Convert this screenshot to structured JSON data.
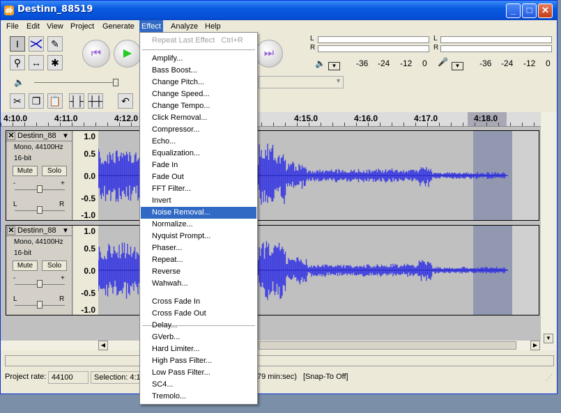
{
  "window": {
    "title": "Destinn_88519"
  },
  "titlebar_buttons": [
    "_",
    "□",
    "✕"
  ],
  "menu": [
    {
      "label": "File",
      "active": false
    },
    {
      "label": "Edit",
      "active": false
    },
    {
      "label": "View",
      "active": false
    },
    {
      "label": "Project",
      "active": false
    },
    {
      "label": "Generate",
      "active": false
    },
    {
      "label": "Effect",
      "active": true
    },
    {
      "label": "Analyze",
      "active": false
    },
    {
      "label": "Help",
      "active": false
    }
  ],
  "effect_menu": {
    "repeat_last": "Repeat Last Effect",
    "repeat_shortcut": "Ctrl+R",
    "group1": [
      "Amplify...",
      "Bass Boost...",
      "Change Pitch...",
      "Change Speed...",
      "Change Tempo...",
      "Click Removal...",
      "Compressor...",
      "Echo...",
      "Equalization...",
      "Fade In",
      "Fade Out",
      "FFT Filter...",
      "Invert",
      "Noise Removal...",
      "Normalize...",
      "Nyquist Prompt...",
      "Phaser...",
      "Repeat...",
      "Reverse",
      "Wahwah..."
    ],
    "group2": [
      "Cross Fade In",
      "Cross Fade Out",
      "Delay...",
      "GVerb...",
      "Hard Limiter...",
      "High Pass Filter...",
      "Low Pass Filter...",
      "SC4...",
      "Tremolo..."
    ],
    "highlighted": "Noise Removal..."
  },
  "meters": {
    "playback_scale": [
      "-36",
      "-24",
      "-12",
      "0"
    ],
    "record_scale": [
      "-36",
      "-24",
      "-12",
      "0"
    ],
    "lr": [
      "L",
      "R"
    ]
  },
  "ruler": {
    "labels": [
      "4:10.0",
      "4:11.0",
      "4:12.0",
      "4:15.0",
      "4:16.0",
      "4:17.0",
      "4:18.0"
    ]
  },
  "tracks": [
    {
      "name": "Destinn_88",
      "info1": "Mono, 44100Hz",
      "info2": "16-bit",
      "mute": "Mute",
      "solo": "Solo",
      "gain_minus": "-",
      "gain_plus": "+",
      "pan_l": "L",
      "pan_r": "R",
      "scale": [
        "1.0",
        "0.5",
        "0.0",
        "-0.5",
        "-1.0"
      ]
    },
    {
      "name": "Destinn_88",
      "info1": "Mono, 44100Hz",
      "info2": "16-bit",
      "mute": "Mute",
      "solo": "Solo",
      "gain_minus": "-",
      "gain_plus": "+",
      "pan_l": "L",
      "pan_r": "R",
      "scale": [
        "1.0",
        "0.5",
        "0.0",
        "-0.5",
        "-1.0"
      ]
    }
  ],
  "status": {
    "project_rate_label": "Project rate:",
    "project_rate": "44100",
    "selection": "Selection: 4:1",
    "duration_tail": "79 min:sec)",
    "snap": "[Snap-To Off]"
  },
  "colors": {
    "waveform": "#3f3fe0",
    "highlight": "#316ac5",
    "title_bar": "#0a5ae0",
    "track_bg": "#c0c0c0",
    "selection": "#9298b0"
  }
}
